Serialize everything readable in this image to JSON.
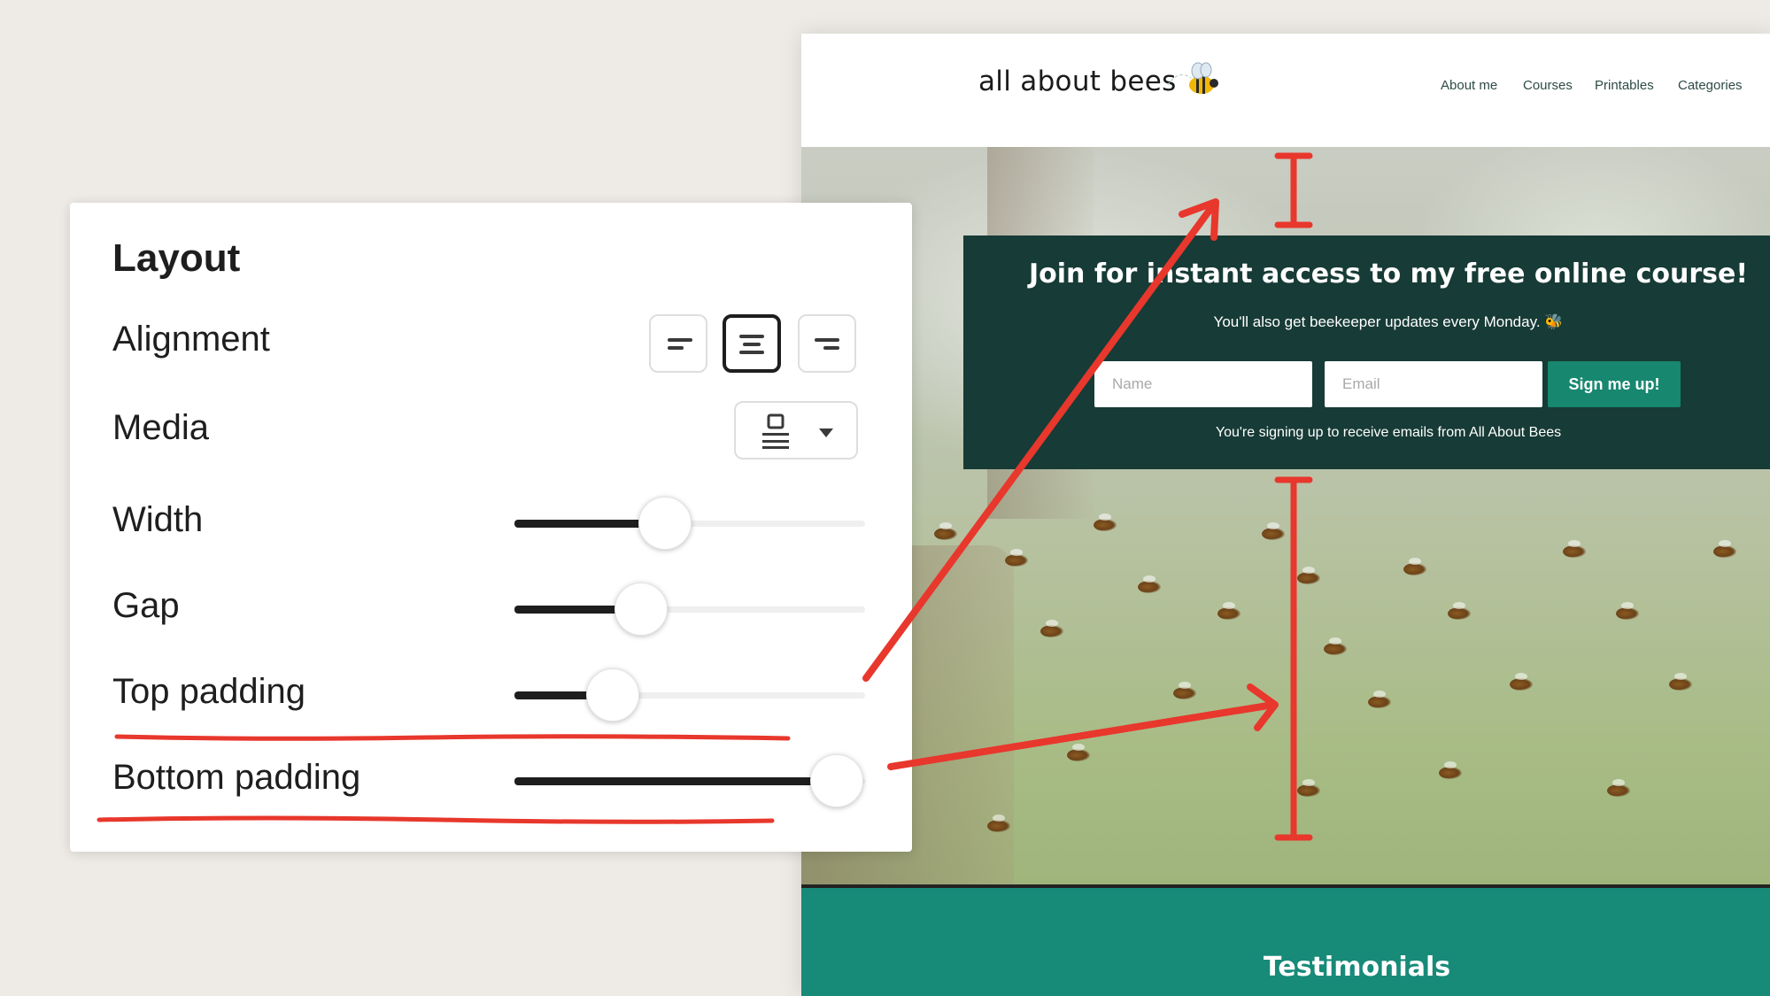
{
  "site": {
    "logo_text": "all about bees",
    "nav": [
      "About me",
      "Courses",
      "Printables",
      "Categories"
    ],
    "signup": {
      "title": "Join for instant access to my free online course!",
      "subtitle": "You'll also get beekeeper updates every Monday. 🐝",
      "name_placeholder": "Name",
      "email_placeholder": "Email",
      "button_label": "Sign me up!",
      "note": "You're signing up to receive emails from All About Bees"
    },
    "testimonials_title": "Testimonials",
    "colors": {
      "signup_bg": "#173b36",
      "button_bg": "#17876f",
      "testimonials_bg": "#178a78"
    }
  },
  "panel": {
    "title": "Layout",
    "alignment": {
      "label": "Alignment",
      "options": [
        "align-left-icon",
        "align-center-icon",
        "align-right-icon"
      ],
      "selected": "align-center-icon"
    },
    "media": {
      "label": "Media",
      "icon": "media-layout-icon"
    },
    "sliders": {
      "width": {
        "label": "Width",
        "value_fraction": 0.43
      },
      "gap": {
        "label": "Gap",
        "value_fraction": 0.36
      },
      "top_padding": {
        "label": "Top padding",
        "value_fraction": 0.28
      },
      "bottom_padding": {
        "label": "Bottom padding",
        "value_fraction": 0.92
      }
    }
  },
  "annotation_color": "#e8372c"
}
